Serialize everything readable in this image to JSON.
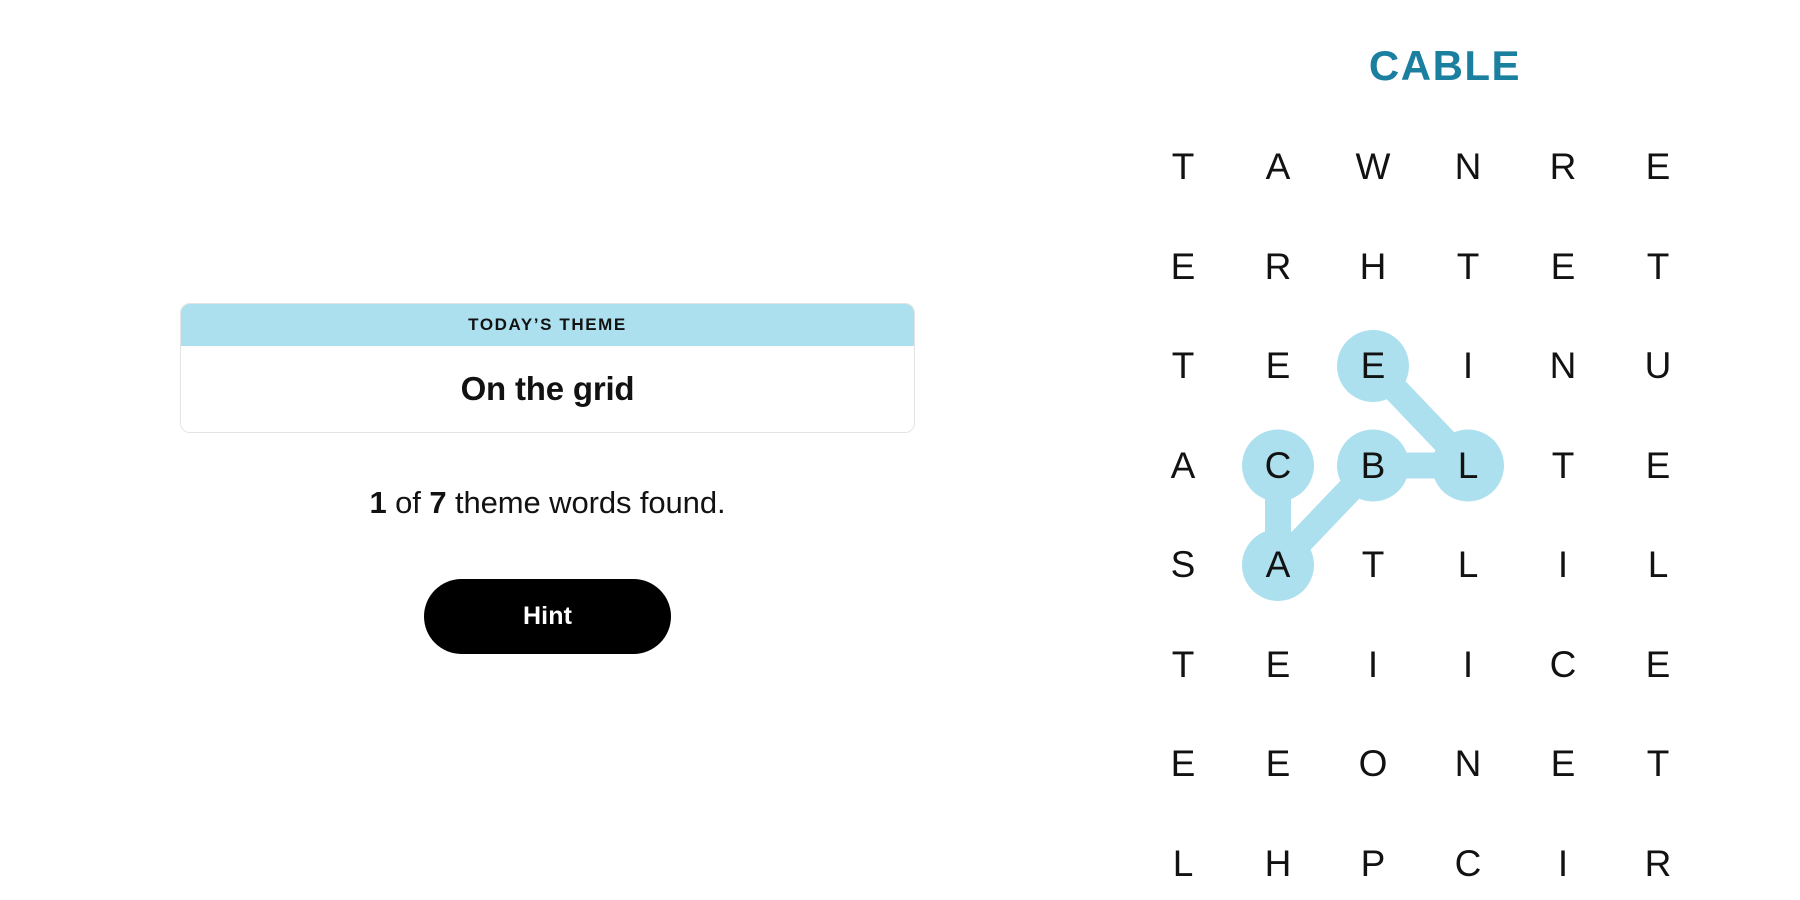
{
  "puzzle": {
    "found_word_title": "CABLE"
  },
  "theme_card": {
    "header_label": "TODAY’S THEME",
    "title": "On the grid"
  },
  "progress": {
    "found_count": "1",
    "prefix_spacer": " of ",
    "total_count": "7",
    "suffix": " theme words found.",
    "full_text": "1 of 7 theme words found."
  },
  "hint": {
    "label": "Hint"
  },
  "colors": {
    "accent_teal": "#1b7fa0",
    "highlight_blue": "#ace0ee",
    "button_black": "#000000",
    "text_black": "#121212",
    "card_border": "#e3e3e3",
    "page_background": "#ffffff"
  },
  "grid": {
    "rows": 8,
    "cols": 6,
    "letters": [
      [
        "T",
        "A",
        "W",
        "N",
        "R",
        "E"
      ],
      [
        "E",
        "R",
        "H",
        "T",
        "E",
        "T"
      ],
      [
        "T",
        "E",
        "E",
        "I",
        "N",
        "U"
      ],
      [
        "A",
        "C",
        "B",
        "L",
        "T",
        "E"
      ],
      [
        "S",
        "A",
        "T",
        "L",
        "I",
        "L"
      ],
      [
        "T",
        "E",
        "I",
        "I",
        "C",
        "E"
      ],
      [
        "E",
        "E",
        "O",
        "N",
        "E",
        "T"
      ],
      [
        "L",
        "H",
        "P",
        "C",
        "I",
        "R"
      ]
    ],
    "selected_path": {
      "word": "CABLE",
      "cells": [
        {
          "row": 3,
          "col": 1,
          "letter": "C"
        },
        {
          "row": 4,
          "col": 1,
          "letter": "A"
        },
        {
          "row": 3,
          "col": 2,
          "letter": "B"
        },
        {
          "row": 3,
          "col": 3,
          "letter": "L"
        },
        {
          "row": 2,
          "col": 2,
          "letter": "E"
        }
      ]
    }
  }
}
